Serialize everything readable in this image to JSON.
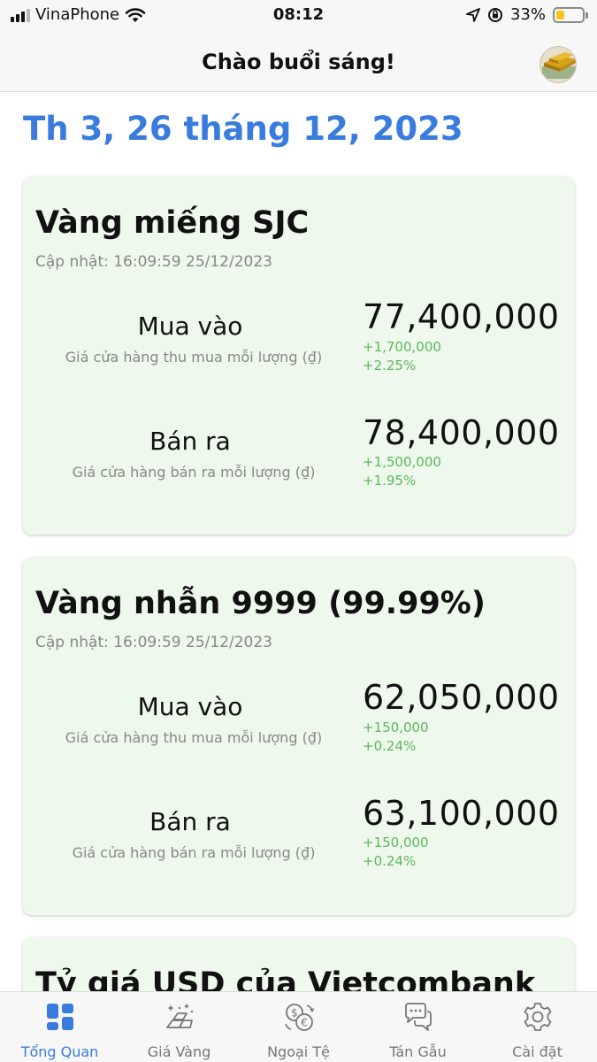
{
  "status_bar": {
    "carrier": "VinaPhone",
    "time": "08:12",
    "battery": "33%",
    "battery_level": 0.33
  },
  "header": {
    "title": "Chào buổi sáng!"
  },
  "date": "Th 3, 26 tháng 12, 2023",
  "cards": [
    {
      "title": "Vàng miếng SJC",
      "updated": "Cập nhật: 16:09:59 25/12/2023",
      "buy": {
        "label": "Mua vào",
        "sub": "Giá cửa hàng thu mua mỗi lượng (₫)",
        "price": "77,400,000",
        "change": "+1,700,000",
        "change_pct": "+2.25%"
      },
      "sell": {
        "label": "Bán ra",
        "sub": "Giá cửa hàng bán ra mỗi lượng (₫)",
        "price": "78,400,000",
        "change": "+1,500,000",
        "change_pct": "+1.95%"
      }
    },
    {
      "title": "Vàng nhẫn 9999 (99.99%)",
      "updated": "Cập nhật: 16:09:59 25/12/2023",
      "buy": {
        "label": "Mua vào",
        "sub": "Giá cửa hàng thu mua mỗi lượng (₫)",
        "price": "62,050,000",
        "change": "+150,000",
        "change_pct": "+0.24%"
      },
      "sell": {
        "label": "Bán ra",
        "sub": "Giá cửa hàng bán ra mỗi lượng (₫)",
        "price": "63,100,000",
        "change": "+150,000",
        "change_pct": "+0.24%"
      }
    },
    {
      "title": "Tỷ giá USD của Vietcombank"
    }
  ],
  "tabs": [
    {
      "label": "Tổng Quan",
      "icon": "dashboard-icon",
      "active": true
    },
    {
      "label": "Giá Vàng",
      "icon": "gold-bars-icon",
      "active": false
    },
    {
      "label": "Ngoại Tệ",
      "icon": "currency-exchange-icon",
      "active": false
    },
    {
      "label": "Tán Gẫu",
      "icon": "chat-bubbles-icon",
      "active": false
    },
    {
      "label": "Cài đặt",
      "icon": "gear-icon",
      "active": false
    }
  ],
  "colors": {
    "accent": "#3a7bde",
    "card_bg": "#eef8ec",
    "positive": "#5cb85c"
  }
}
